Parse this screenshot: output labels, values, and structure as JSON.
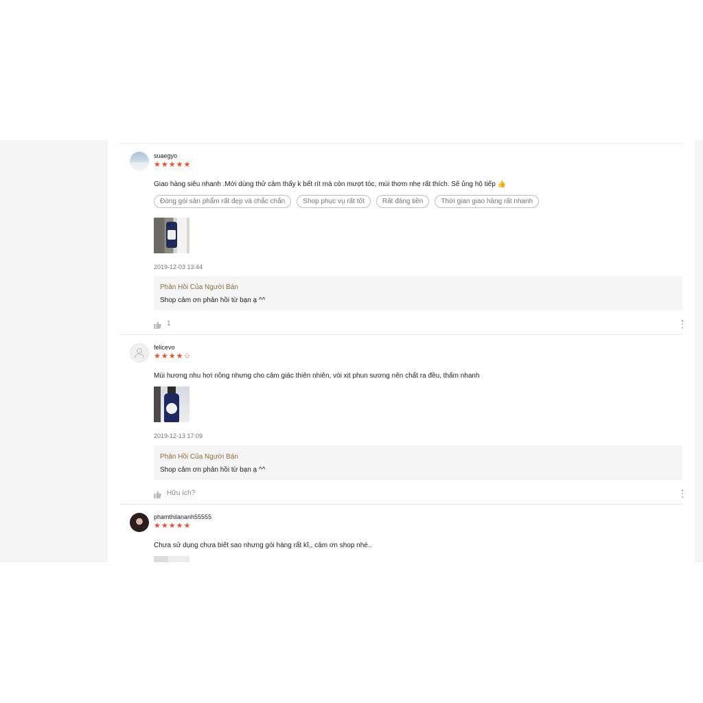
{
  "reviews": [
    {
      "username": "suaegyo",
      "rating": 5,
      "stars": [
        "★",
        "★",
        "★",
        "★",
        "★"
      ],
      "comment": "Giao hàng siêu nhanh .Mới dùng thử cảm thấy k bết rít mà còn mượt tóc, mùi thơm nhẹ rất thích. Sẽ ủng hộ tiếp 👍",
      "tags": [
        "Đóng gói sản phẩm rất đẹp và chắc chắn",
        "Shop phục vụ rất tốt",
        "Rất đáng tiền",
        "Thời gian giao hàng rất nhanh"
      ],
      "timestamp": "2019-12-03 13:44",
      "seller_reply_title": "Phản Hồi Của Người Bán",
      "seller_reply_text": "Shop cảm ơn phản hồi từ bạn ạ ^^",
      "likes": "1"
    },
    {
      "username": "felicevo",
      "rating": 4,
      "stars": [
        "★",
        "★",
        "★",
        "★",
        "☆"
      ],
      "comment": "Mùi hương nhu hơi nồng nhưng cho cảm giác thiên nhiên, vòi xịt phun sương nên chất ra đều, thấm nhanh",
      "tags": [],
      "timestamp": "2019-12-13 17:09",
      "seller_reply_title": "Phản Hồi Của Người Bán",
      "seller_reply_text": "Shop cảm ơn phản hồi từ bạn ạ ^^",
      "likes": "Hữu ích?"
    },
    {
      "username": "phamthilananh55555",
      "rating": 5,
      "stars": [
        "★",
        "★",
        "★",
        "★",
        "★"
      ],
      "comment": "Chưa sử dụng chưa biết sao nhưng gói hàng rất kĩ,, cảm ơn shop nhé..",
      "tags": []
    }
  ],
  "colors": {
    "star": "#ee4d2d",
    "seller_reply_title": "#8a6d3b",
    "reply_background": "#f5f5f5",
    "page_background": "#f5f5f5"
  },
  "icons": {
    "like": "thumbs-up-icon",
    "more": "more-vertical-icon",
    "avatar_default": "user-icon"
  }
}
